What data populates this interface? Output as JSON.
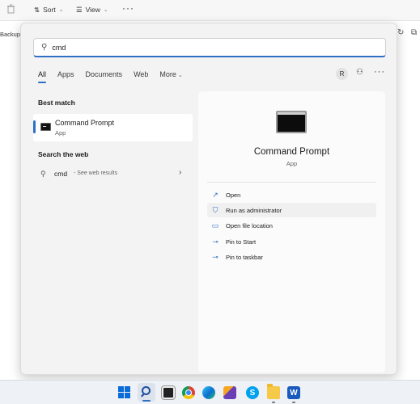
{
  "background": {
    "toolbar": {
      "sort_label": "Sort",
      "view_label": "View",
      "more": "···"
    },
    "breadcrumb_fragment": "Backup"
  },
  "search": {
    "query": "cmd",
    "tabs": [
      {
        "label": "All",
        "active": true
      },
      {
        "label": "Apps"
      },
      {
        "label": "Documents"
      },
      {
        "label": "Web"
      },
      {
        "label": "More"
      }
    ],
    "avatar_initial": "R",
    "more": "···"
  },
  "results": {
    "best_match_label": "Best match",
    "best_match": {
      "title": "Command Prompt",
      "subtitle": "App"
    },
    "web_label": "Search the web",
    "web": {
      "query": "cmd",
      "hint": "- See web results"
    }
  },
  "detail": {
    "title": "Command Prompt",
    "subtitle": "App",
    "actions": [
      {
        "label": "Open",
        "icon": "open-icon"
      },
      {
        "label": "Run as administrator",
        "icon": "shield-icon"
      },
      {
        "label": "Open file location",
        "icon": "folder-icon"
      },
      {
        "label": "Pin to Start",
        "icon": "pin-icon"
      },
      {
        "label": "Pin to taskbar",
        "icon": "pin-icon"
      }
    ]
  },
  "taskbar": {
    "skype_letter": "S",
    "word_letter": "W",
    "apps": [
      "start-icon",
      "search-icon",
      "task-view-icon",
      "chrome-icon",
      "edge-icon",
      "snipping-tool-icon",
      "skype-icon",
      "file-explorer-icon",
      "word-icon"
    ]
  },
  "colors": {
    "accent": "#2f6fc4",
    "panel": "#f3f3f3",
    "taskbar": "#eef1f6"
  }
}
